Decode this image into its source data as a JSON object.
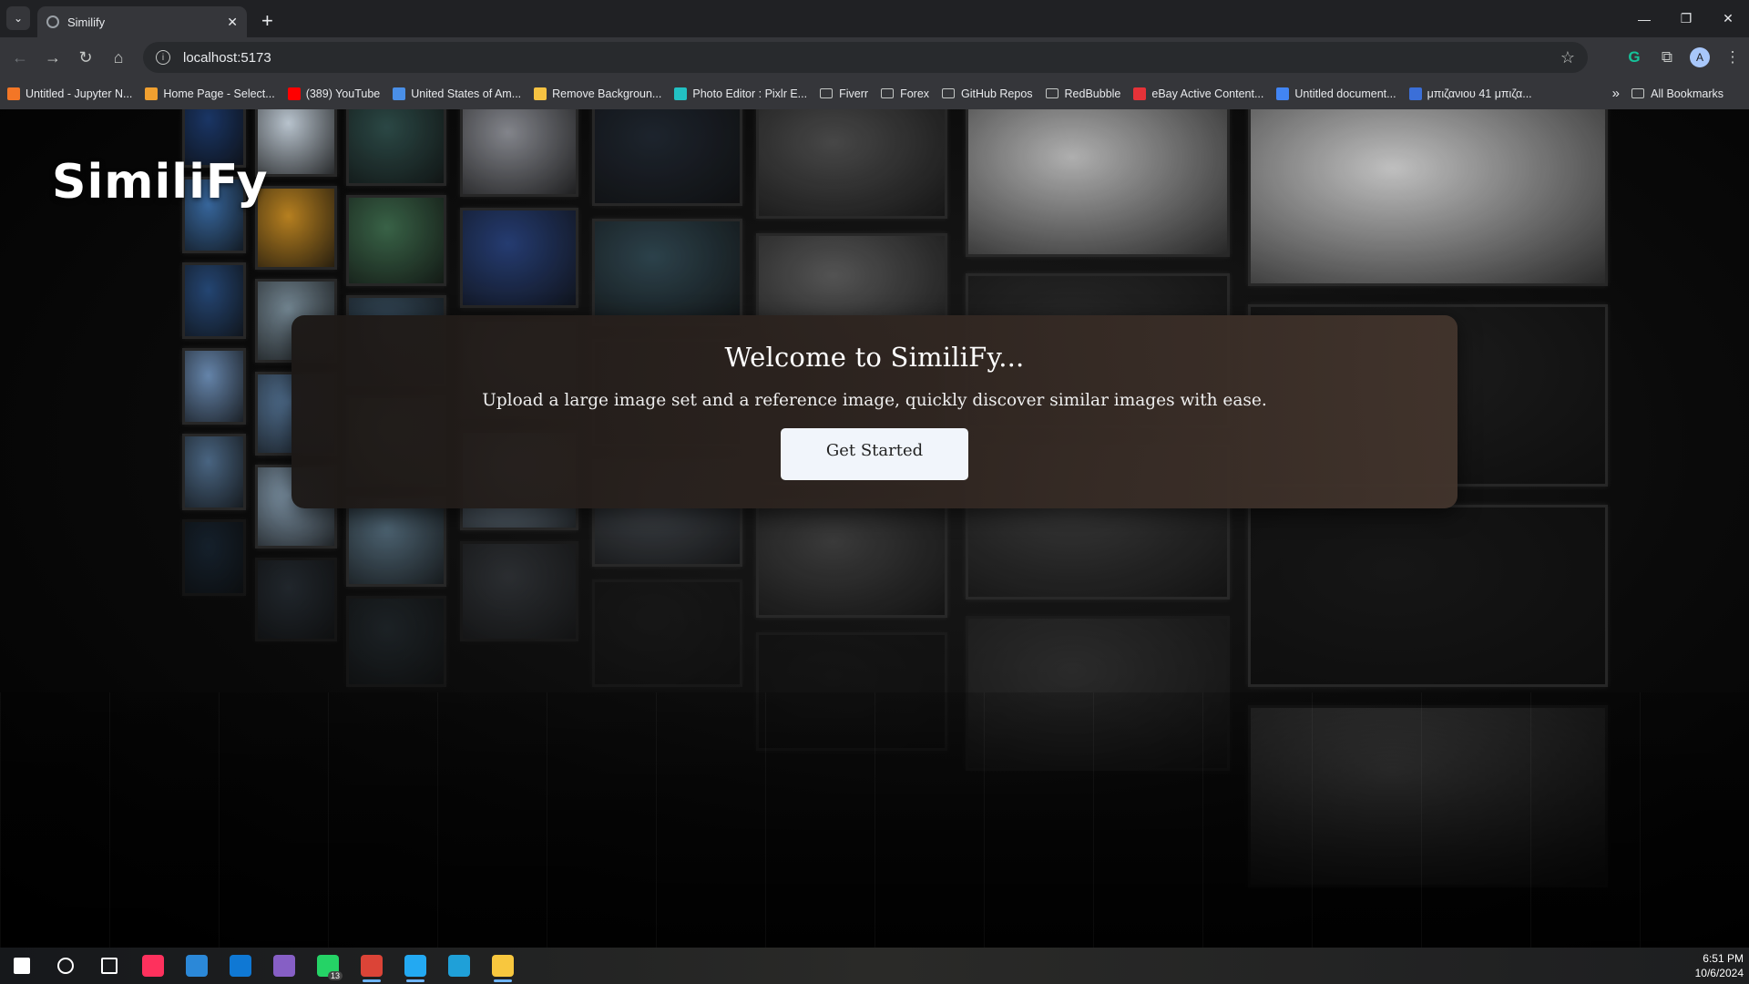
{
  "browser": {
    "tab_title": "Similify",
    "new_tab_symbol": "+",
    "close_symbol": "✕",
    "url": "localhost:5173",
    "window_controls": [
      "—",
      "❐",
      "✕"
    ]
  },
  "nav": {
    "back": "←",
    "forward": "→",
    "reload": "↻",
    "home": "⌂",
    "star": "☆",
    "extension_icons": [
      "G",
      "⧉"
    ],
    "avatar_letter": "A",
    "menu": "⋮"
  },
  "bookmarks": {
    "items": [
      {
        "label": "Untitled - Jupyter N...",
        "icon": "jupyter-icon",
        "color": "#f37626"
      },
      {
        "label": "Home Page - Select...",
        "icon": "loading-icon",
        "color": "#f0a030"
      },
      {
        "label": "(389) YouTube",
        "icon": "youtube-icon",
        "color": "#ff0000"
      },
      {
        "label": "United States of Am...",
        "icon": "document-icon",
        "color": "#4a8fe7"
      },
      {
        "label": "Remove Backgroun...",
        "icon": "removebg-icon",
        "color": "#f5c242"
      },
      {
        "label": "Photo Editor : Pixlr E...",
        "icon": "pixlr-icon",
        "color": "#22c1c3"
      },
      {
        "label": "Fiverr",
        "icon": "folder-icon",
        "color": ""
      },
      {
        "label": "Forex",
        "icon": "folder-icon",
        "color": ""
      },
      {
        "label": "GitHub Repos",
        "icon": "folder-icon",
        "color": ""
      },
      {
        "label": "RedBubble",
        "icon": "folder-icon",
        "color": ""
      },
      {
        "label": "eBay Active Content...",
        "icon": "ebay-icon",
        "color": "#e53238"
      },
      {
        "label": "Untitled document...",
        "icon": "docs-icon",
        "color": "#4285f4"
      },
      {
        "label": "μπιζανιου 41 μπιζα...",
        "icon": "site-icon",
        "color": "#3b6fd8"
      }
    ],
    "more": "»",
    "all_bookmarks": "All Bookmarks"
  },
  "page": {
    "logo": "SimiliFy",
    "hero_title": "Welcome to SimiliFy...",
    "hero_subtitle": "Upload a large image set and a reference image, quickly discover similar images with ease.",
    "cta_label": "Get Started"
  },
  "taskbar": {
    "apps": [
      {
        "name": "start-icon",
        "color": "#ffffff"
      },
      {
        "name": "search-icon",
        "color": "#ffffff"
      },
      {
        "name": "task-view-icon",
        "color": "#ffffff"
      },
      {
        "name": "intellij-icon",
        "color": "#fe315d"
      },
      {
        "name": "store-icon",
        "color": "#2b88d8"
      },
      {
        "name": "mail-icon",
        "color": "#0f78d4"
      },
      {
        "name": "visual-studio-icon",
        "color": "#865fc5"
      },
      {
        "name": "whatsapp-icon",
        "color": "#25d366"
      },
      {
        "name": "chrome-icon",
        "color": "#db4437"
      },
      {
        "name": "vscode-icon",
        "color": "#23a9f2"
      },
      {
        "name": "edge-icon",
        "color": "#1fa0d8"
      },
      {
        "name": "file-explorer-icon",
        "color": "#f8c73e"
      }
    ],
    "whatsapp_badge": "13",
    "time": "6:51 PM",
    "date": "10/6/2024"
  }
}
